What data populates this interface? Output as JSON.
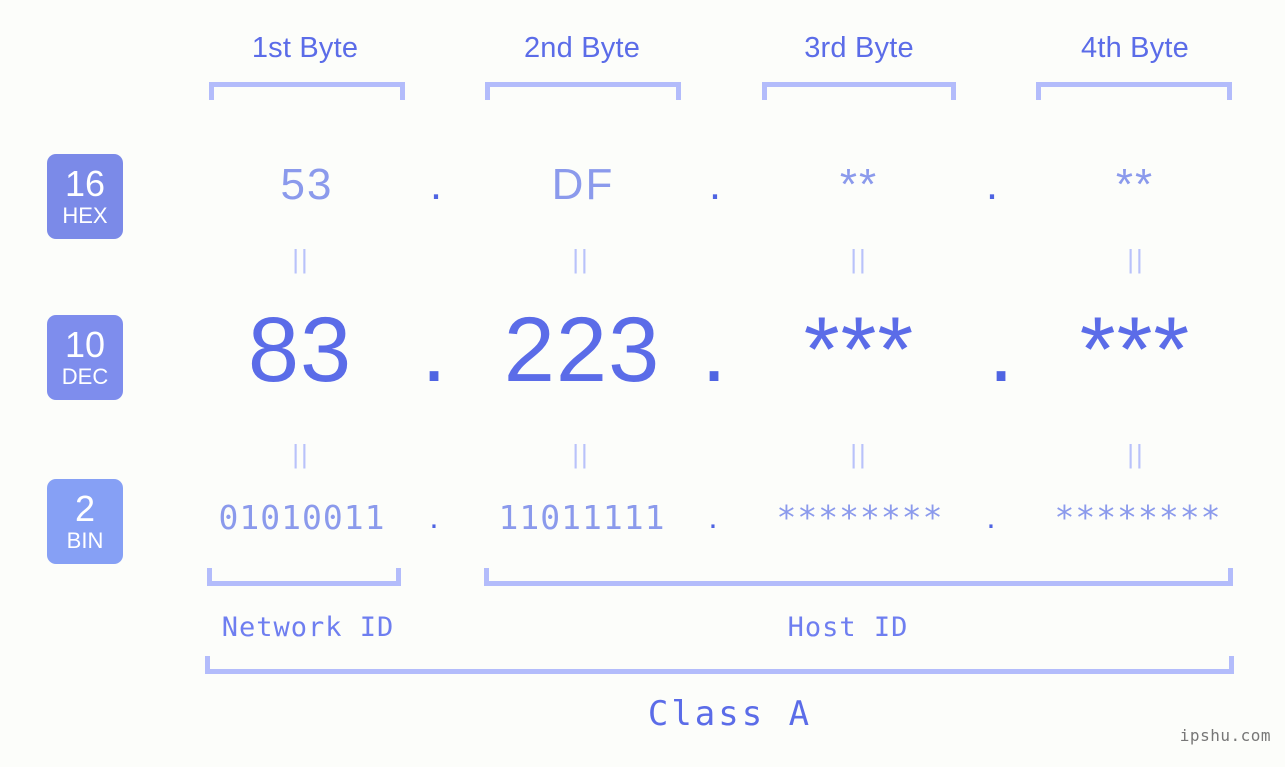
{
  "page": {
    "background_color": "#fcfdfa",
    "accent_color": "#5b6ce8",
    "accent_light_color": "#b3bcfb",
    "badge_color": "#7b8ae8",
    "watermark": "ipshu.com"
  },
  "byte_headers": [
    {
      "label": "1st Byte"
    },
    {
      "label": "2nd Byte"
    },
    {
      "label": "3rd Byte"
    },
    {
      "label": "4th Byte"
    }
  ],
  "bases": [
    {
      "number": "16",
      "name": "HEX"
    },
    {
      "number": "10",
      "name": "DEC"
    },
    {
      "number": "2",
      "name": "BIN"
    }
  ],
  "rows": {
    "hex": {
      "base_number": "16",
      "base_name": "HEX",
      "values": [
        "53",
        "DF",
        "**",
        "**"
      ],
      "separator": "."
    },
    "dec": {
      "base_number": "10",
      "base_name": "DEC",
      "values": [
        "83",
        "223",
        "***",
        "***"
      ],
      "separator": "."
    },
    "bin": {
      "base_number": "2",
      "base_name": "BIN",
      "values": [
        "01010011",
        "11011111",
        "********",
        "********"
      ],
      "separator": "."
    }
  },
  "equivalence_mark": "||",
  "segments": {
    "network_id": "Network ID",
    "host_id": "Host ID",
    "class": "Class A"
  }
}
